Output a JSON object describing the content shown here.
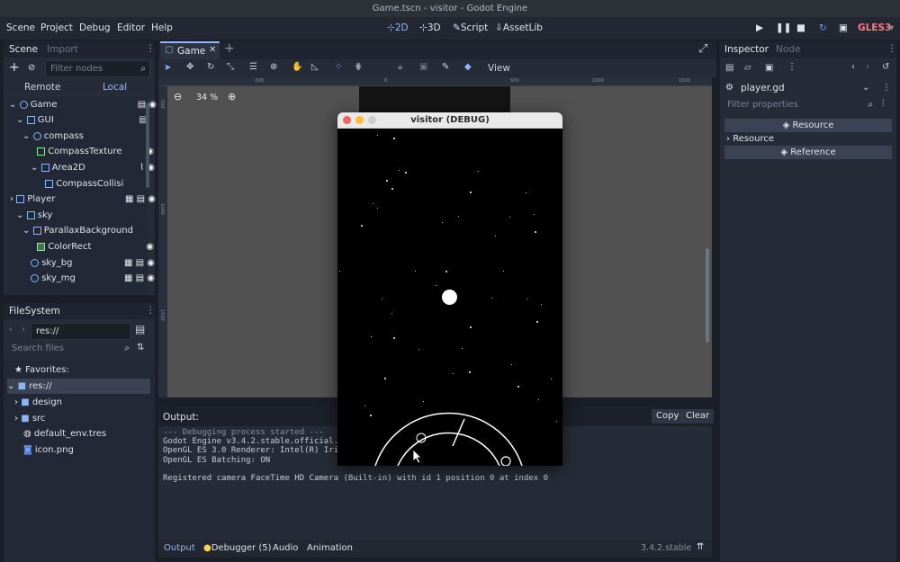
{
  "window_title": "Game.tscn - visitor - Godot Engine",
  "menu": [
    "Scene",
    "Project",
    "Debug",
    "Editor",
    "Help"
  ],
  "workspaces": [
    "2D",
    "3D",
    "Script",
    "AssetLib"
  ],
  "renderer": "GLES3",
  "scene_dock": {
    "tabs": [
      "Scene",
      "Import"
    ],
    "filter_placeholder": "Filter nodes",
    "remote": "Remote",
    "local": "Local",
    "nodes": [
      "Game",
      "GUI",
      "compass",
      "CompassTexture",
      "Area2D",
      "CompassCollisi",
      "Player",
      "sky",
      "ParallaxBackground",
      "ColorRect",
      "sky_bg",
      "sky_mg"
    ]
  },
  "filesystem": {
    "tab": "FileSystem",
    "path": "res://",
    "search_placeholder": "Search files",
    "favorites": "Favorites:",
    "items": [
      "res://",
      "design",
      "src",
      "default_env.tres",
      "icon.png"
    ]
  },
  "editor": {
    "tab": "Game",
    "zoom": "34 %",
    "view_label": "View",
    "ruler": [
      "-500",
      "0",
      "500",
      "1000",
      "1500"
    ],
    "vruler": [
      "500",
      "1000",
      "1500"
    ]
  },
  "output": {
    "title": "Output:",
    "copy": "Copy",
    "clear": "Clear",
    "lines": [
      "--- Debugging process started ---",
      "Godot Engine v3.4.2.stable.official.",
      "OpenGL ES 3.0 Renderer: Intel(R) Iri",
      "OpenGL ES Batching: ON",
      "",
      "Registered camera FaceTime HD Camera (Built-in) with id 1 position 0 at index 0"
    ],
    "bottom_tabs": [
      "Output",
      "Debugger (5)",
      "Audio",
      "Animation"
    ],
    "version": "3.4.2.stable"
  },
  "inspector": {
    "tabs": [
      "Inspector",
      "Node"
    ],
    "resource_file": "player.gd",
    "filter_placeholder": "Filter properties",
    "rows": [
      "Resource",
      "Resource",
      "Reference"
    ]
  },
  "game_window": {
    "title": "visitor (DEBUG)"
  },
  "colors": {
    "accent": "#8fb8ff",
    "bg": "#1a1e27",
    "panel": "#262c37"
  }
}
